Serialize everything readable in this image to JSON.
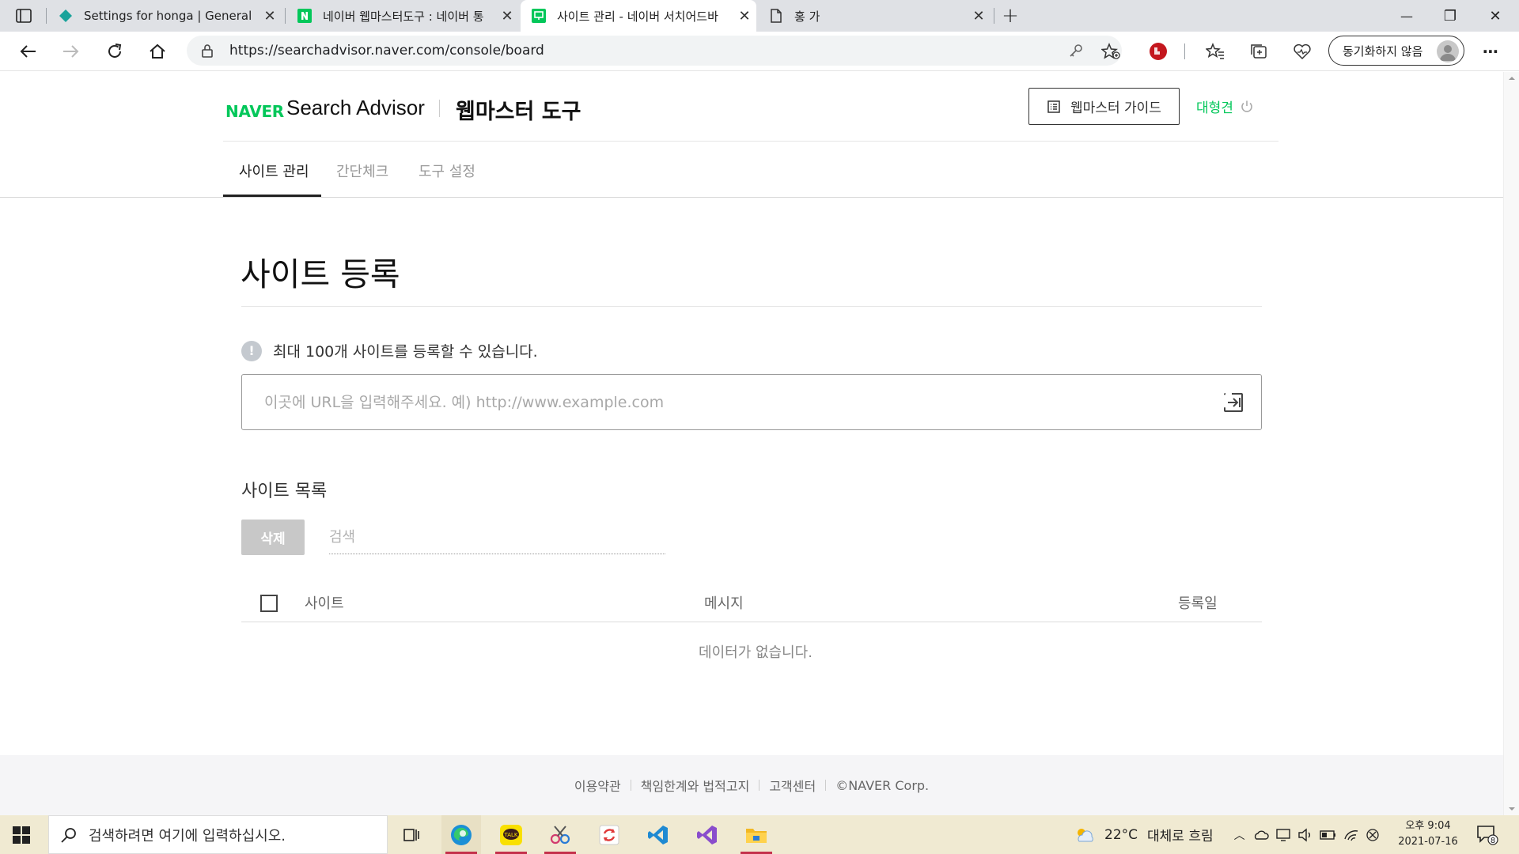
{
  "browser": {
    "tabs": [
      {
        "title": "Settings for honga | General",
        "active": false
      },
      {
        "title": "네이버 웹마스터도구 : 네이버 통",
        "active": false
      },
      {
        "title": "사이트 관리 - 네이버 서치어드바",
        "active": true
      },
      {
        "title": "홍 가",
        "active": false
      }
    ],
    "new_tab": "+",
    "window": {
      "minimize": "—",
      "restore": "❐",
      "close": "✕"
    },
    "url": "https://searchadvisor.naver.com/console/board",
    "sync_label": "동기화하지 않음",
    "menu": "⋯"
  },
  "header": {
    "brand": "NAVER",
    "product": "Search Advisor",
    "section": "웹마스터 도구",
    "guide_button": "웹마스터 가이드",
    "user_name": "대형견"
  },
  "nav": {
    "tabs": [
      {
        "label": "사이트 관리",
        "active": true
      },
      {
        "label": "간단체크",
        "active": false
      },
      {
        "label": "도구 설정",
        "active": false
      }
    ]
  },
  "main": {
    "title": "사이트 등록",
    "notice": "최대 100개 사이트를 등록할 수 있습니다.",
    "notice_icon": "!",
    "url_input_placeholder": "이곳에 URL을 입력해주세요. 예) http://www.example.com",
    "url_input_value": "",
    "list_title": "사이트 목록",
    "delete_button": "삭제",
    "search_placeholder": "검색",
    "table": {
      "columns": [
        "사이트",
        "메시지",
        "등록일"
      ],
      "rows": [],
      "empty_message": "데이터가 없습니다."
    }
  },
  "footer": {
    "links": [
      "이용약관",
      "책임한계와 법적고지",
      "고객센터",
      "©NAVER Corp."
    ]
  },
  "taskbar": {
    "search_placeholder": "검색하려면 여기에 입력하십시오.",
    "weather_temp": "22°C",
    "weather_text": "대체로 흐림",
    "time": "오후 9:04",
    "date": "2021-07-16",
    "notification_count": "8"
  },
  "colors": {
    "naver_green": "#03c75a",
    "tab_bar": "#dfe1e5",
    "taskbar": "#f0ead2"
  }
}
